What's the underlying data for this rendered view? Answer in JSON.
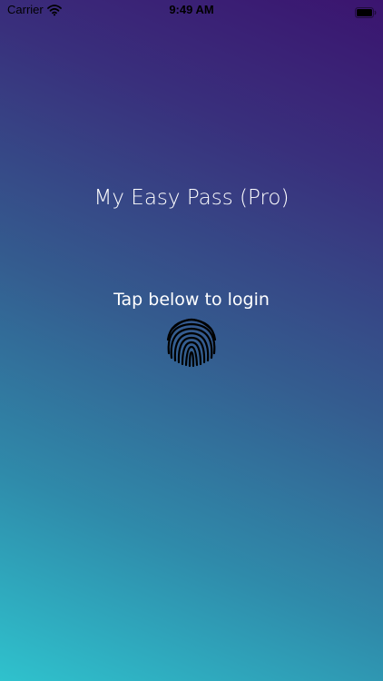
{
  "status_bar": {
    "carrier": "Carrier",
    "time": "9:49 AM",
    "wifi_icon": "wifi-icon",
    "battery_icon": "battery-icon"
  },
  "login": {
    "app_title": "My Easy Pass (Pro)",
    "hint": "Tap below to login",
    "fingerprint_icon": "fingerprint-icon"
  },
  "colors": {
    "gradient_top": "#3b146f",
    "gradient_bottom": "#2fc2cd",
    "text": "#ffffff",
    "icon": "#000000"
  }
}
